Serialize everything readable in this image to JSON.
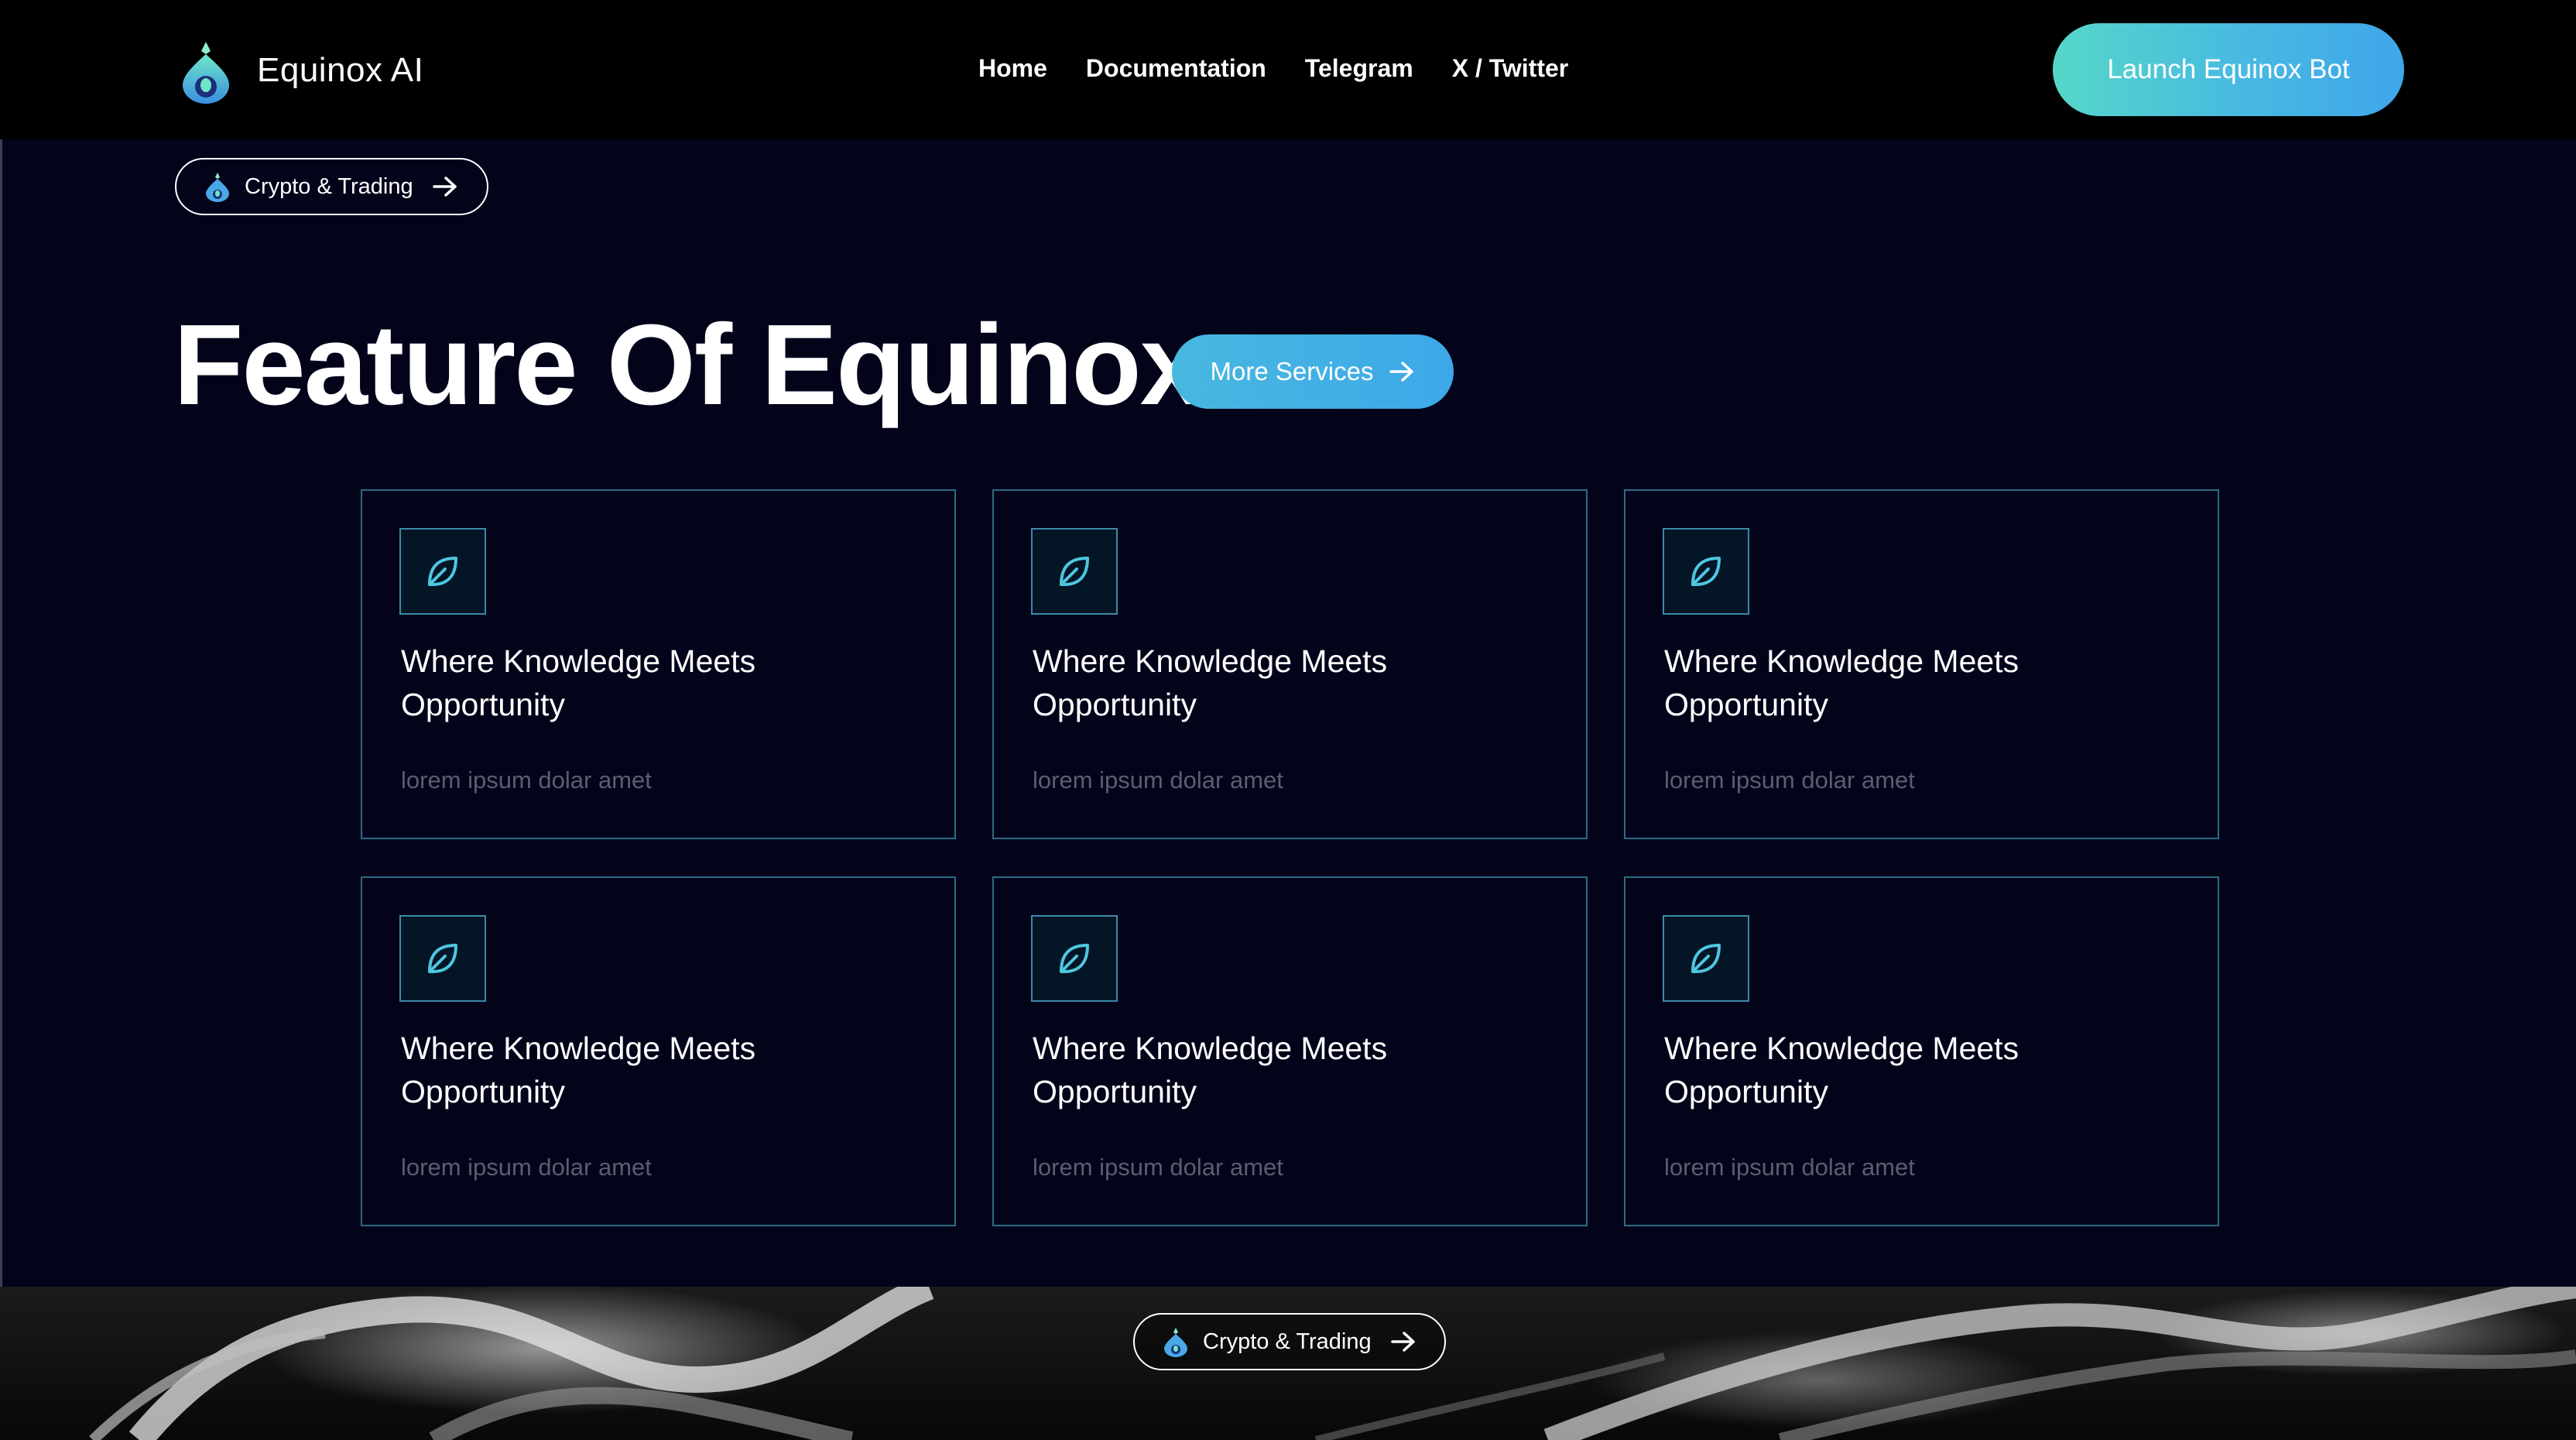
{
  "brand": {
    "name": "Equinox AI",
    "logo_icon": "drop-logo-icon"
  },
  "nav": {
    "links": [
      "Home",
      "Documentation",
      "Telegram",
      "X / Twitter"
    ],
    "cta_label": "Launch Equinox Bot"
  },
  "badge_top": {
    "label": "Crypto & Trading"
  },
  "hero": {
    "title": "Feature Of Equinox",
    "services_label": "More Services"
  },
  "features": [
    {
      "title": "Where Knowledge Meets Opportunity",
      "desc": "lorem ipsum dolar amet",
      "icon": "leaf-icon"
    },
    {
      "title": "Where Knowledge Meets Opportunity",
      "desc": "lorem ipsum dolar amet",
      "icon": "leaf-icon"
    },
    {
      "title": "Where Knowledge Meets Opportunity",
      "desc": "lorem ipsum dolar amet",
      "icon": "leaf-icon"
    },
    {
      "title": "Where Knowledge Meets Opportunity",
      "desc": "lorem ipsum dolar amet",
      "icon": "leaf-icon"
    },
    {
      "title": "Where Knowledge Meets Opportunity",
      "desc": "lorem ipsum dolar amet",
      "icon": "leaf-icon"
    },
    {
      "title": "Where Knowledge Meets Opportunity",
      "desc": "lorem ipsum dolar amet",
      "icon": "leaf-icon"
    }
  ],
  "badge_bottom": {
    "label": "Crypto & Trading"
  },
  "colors": {
    "background": "#03041a",
    "navbar": "#000000",
    "accent_start": "#56d7c8",
    "accent_end": "#3fa6ea",
    "card_border": "#2c6c86",
    "muted_text": "#5a5e70"
  }
}
